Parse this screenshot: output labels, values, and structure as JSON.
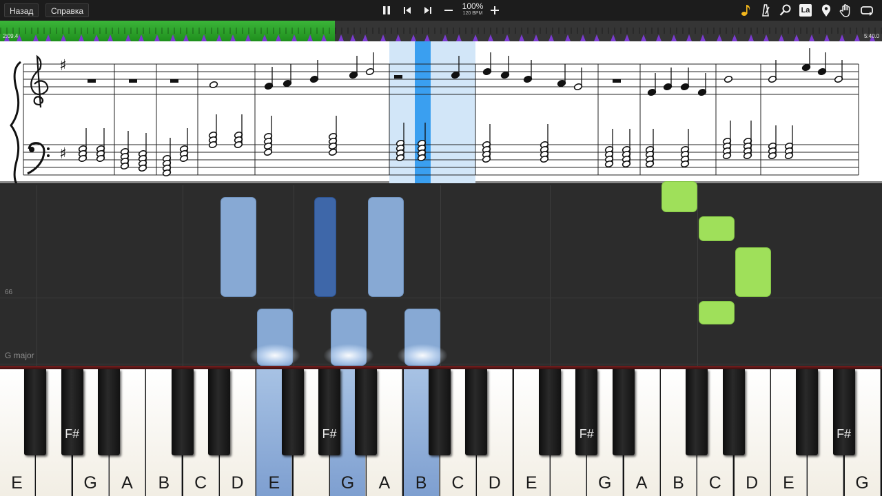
{
  "topbar": {
    "back_label": "Назад",
    "help_label": "Справка",
    "zoom": "100%",
    "bpm": "120 BPM",
    "label_mode": "La"
  },
  "timeline": {
    "elapsed": "2:09.4",
    "total": "5:40.0",
    "progress": 0.38
  },
  "roll": {
    "tick_label": "66",
    "key_label": "G major"
  },
  "keyboard": {
    "white_keys": [
      "E",
      "",
      "G",
      "A",
      "B",
      "C",
      "D",
      "E",
      "",
      "G",
      "A",
      "B",
      "C",
      "D",
      "E",
      "",
      "G",
      "A",
      "B",
      "C",
      "D",
      "E",
      "",
      "G"
    ],
    "pressed_white": [
      7,
      9,
      11
    ],
    "black_keys": [
      {
        "index": 1,
        "label": ""
      },
      {
        "index": 2,
        "label": "F#"
      },
      {
        "index": 3,
        "label": ""
      },
      {
        "index": 5,
        "label": ""
      },
      {
        "index": 6,
        "label": ""
      },
      {
        "index": 8,
        "label": ""
      },
      {
        "index": 9,
        "label": "F#"
      },
      {
        "index": 10,
        "label": ""
      },
      {
        "index": 12,
        "label": ""
      },
      {
        "index": 13,
        "label": ""
      },
      {
        "index": 15,
        "label": ""
      },
      {
        "index": 16,
        "label": "F#"
      },
      {
        "index": 17,
        "label": ""
      },
      {
        "index": 19,
        "label": ""
      },
      {
        "index": 20,
        "label": ""
      },
      {
        "index": 22,
        "label": ""
      },
      {
        "index": 23,
        "label": "F#"
      }
    ]
  },
  "colors": {
    "progress_green": "#2aa828",
    "note_blue": "#87a9d4",
    "note_active_blue": "#3e67a9",
    "note_green": "#9fe05a",
    "marker_purple": "#7b3bd0"
  },
  "icons": [
    "pause-icon",
    "previous-icon",
    "next-icon",
    "minus-icon",
    "plus-icon",
    "note-icon",
    "metronome-icon",
    "magnifier-icon",
    "label-mode-icon",
    "location-pin-icon",
    "hand-icon",
    "loop-icon"
  ]
}
